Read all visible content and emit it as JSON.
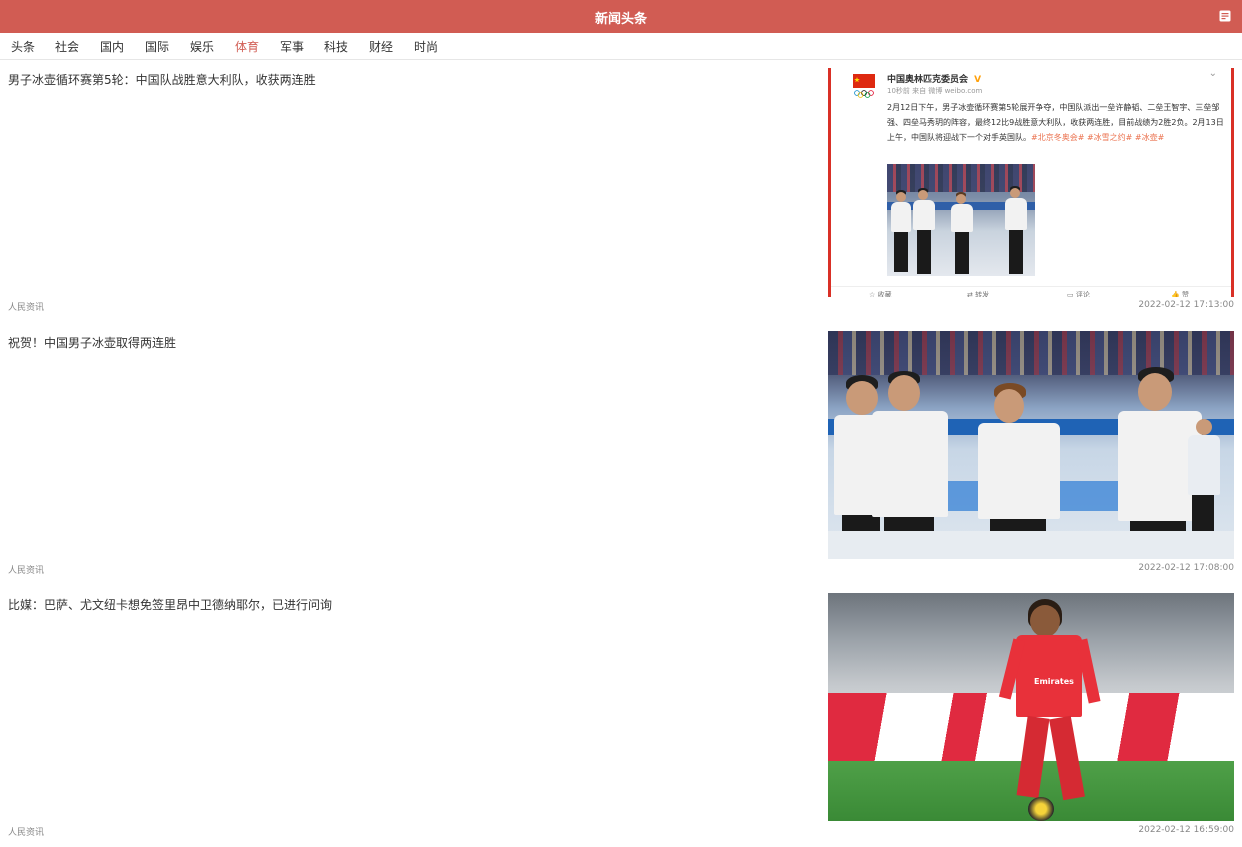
{
  "header": {
    "title": "新闻头条",
    "menu_icon": "menu-icon"
  },
  "tabs": [
    {
      "label": "头条",
      "active": false
    },
    {
      "label": "社会",
      "active": false
    },
    {
      "label": "国内",
      "active": false
    },
    {
      "label": "国际",
      "active": false
    },
    {
      "label": "娱乐",
      "active": false
    },
    {
      "label": "体育",
      "active": true
    },
    {
      "label": "军事",
      "active": false
    },
    {
      "label": "科技",
      "active": false
    },
    {
      "label": "财经",
      "active": false
    },
    {
      "label": "时尚",
      "active": false
    }
  ],
  "articles": [
    {
      "title": "男子冰壶循环赛第5轮：中国队战胜意大利队，收获两连胜",
      "source": "人民资讯",
      "time": "2022-02-12 17:13:00",
      "thumbnail": {
        "type": "weibo-post",
        "account": "中国奥林匹克委员会",
        "meta": "10秒前 来自 微博 weibo.com",
        "text_main": "2月12日下午，男子冰壶循环赛第5轮展开争夺，中国队派出一垒许静韬、二垒王智宇、三垒邹强、四垒马秀玥的阵容，最终12比9战胜意大利队，收获两连胜，目前战绩为2胜2负。2月13日上午，中国队将迎战下一个对手英国队。",
        "tags": "#北京冬奥会# #冰雪之约# #冰壶#",
        "actions": [
          "收藏",
          "转发",
          "评论",
          "赞"
        ]
      }
    },
    {
      "title": "祝贺！中国男子冰壶取得两连胜",
      "source": "人民资讯",
      "time": "2022-02-12 17:08:00",
      "thumbnail": {
        "type": "photo",
        "subject": "curling-team-photo"
      }
    },
    {
      "title": "比媒：巴萨、尤文纽卡想免签里昂中卫德纳耶尔，已进行问询",
      "source": "人民资讯",
      "time": "2022-02-12 16:59:00",
      "thumbnail": {
        "type": "photo",
        "subject": "football-player-photo",
        "jersey_text": "Emirates"
      }
    }
  ],
  "colors": {
    "brand": "#d15c53",
    "active_tab": "#d15c53",
    "pitch": "#3f8f3a",
    "lyon_red": "#e8313a"
  }
}
